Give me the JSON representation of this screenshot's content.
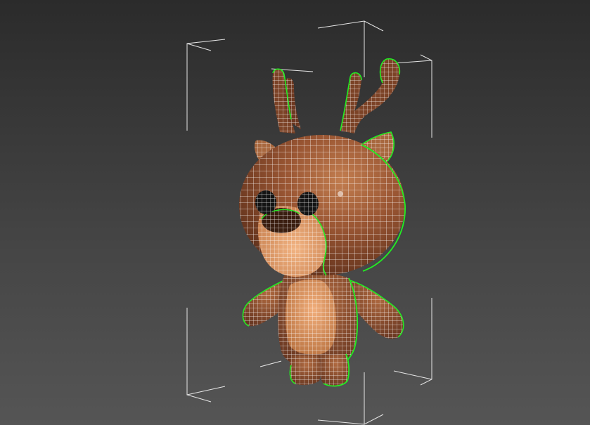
{
  "viewport": {
    "mode": "perspective",
    "background_top": "#2b2b2b",
    "background_bottom": "#555555"
  },
  "scene": {
    "object": "deer",
    "display": "shaded-with-wireframe",
    "selected": true,
    "wire_color": "#ffffff",
    "selection_outline_color": "#22ee22",
    "bracket_color": "#e6e6e6",
    "materials": {
      "fur": "#8a4d2c",
      "fur_highlight": "#b8764a",
      "muzzle": "#e5a26e",
      "belly": "#e09a68",
      "eye": "#141414",
      "ear_inner": "#b97a4c"
    }
  }
}
